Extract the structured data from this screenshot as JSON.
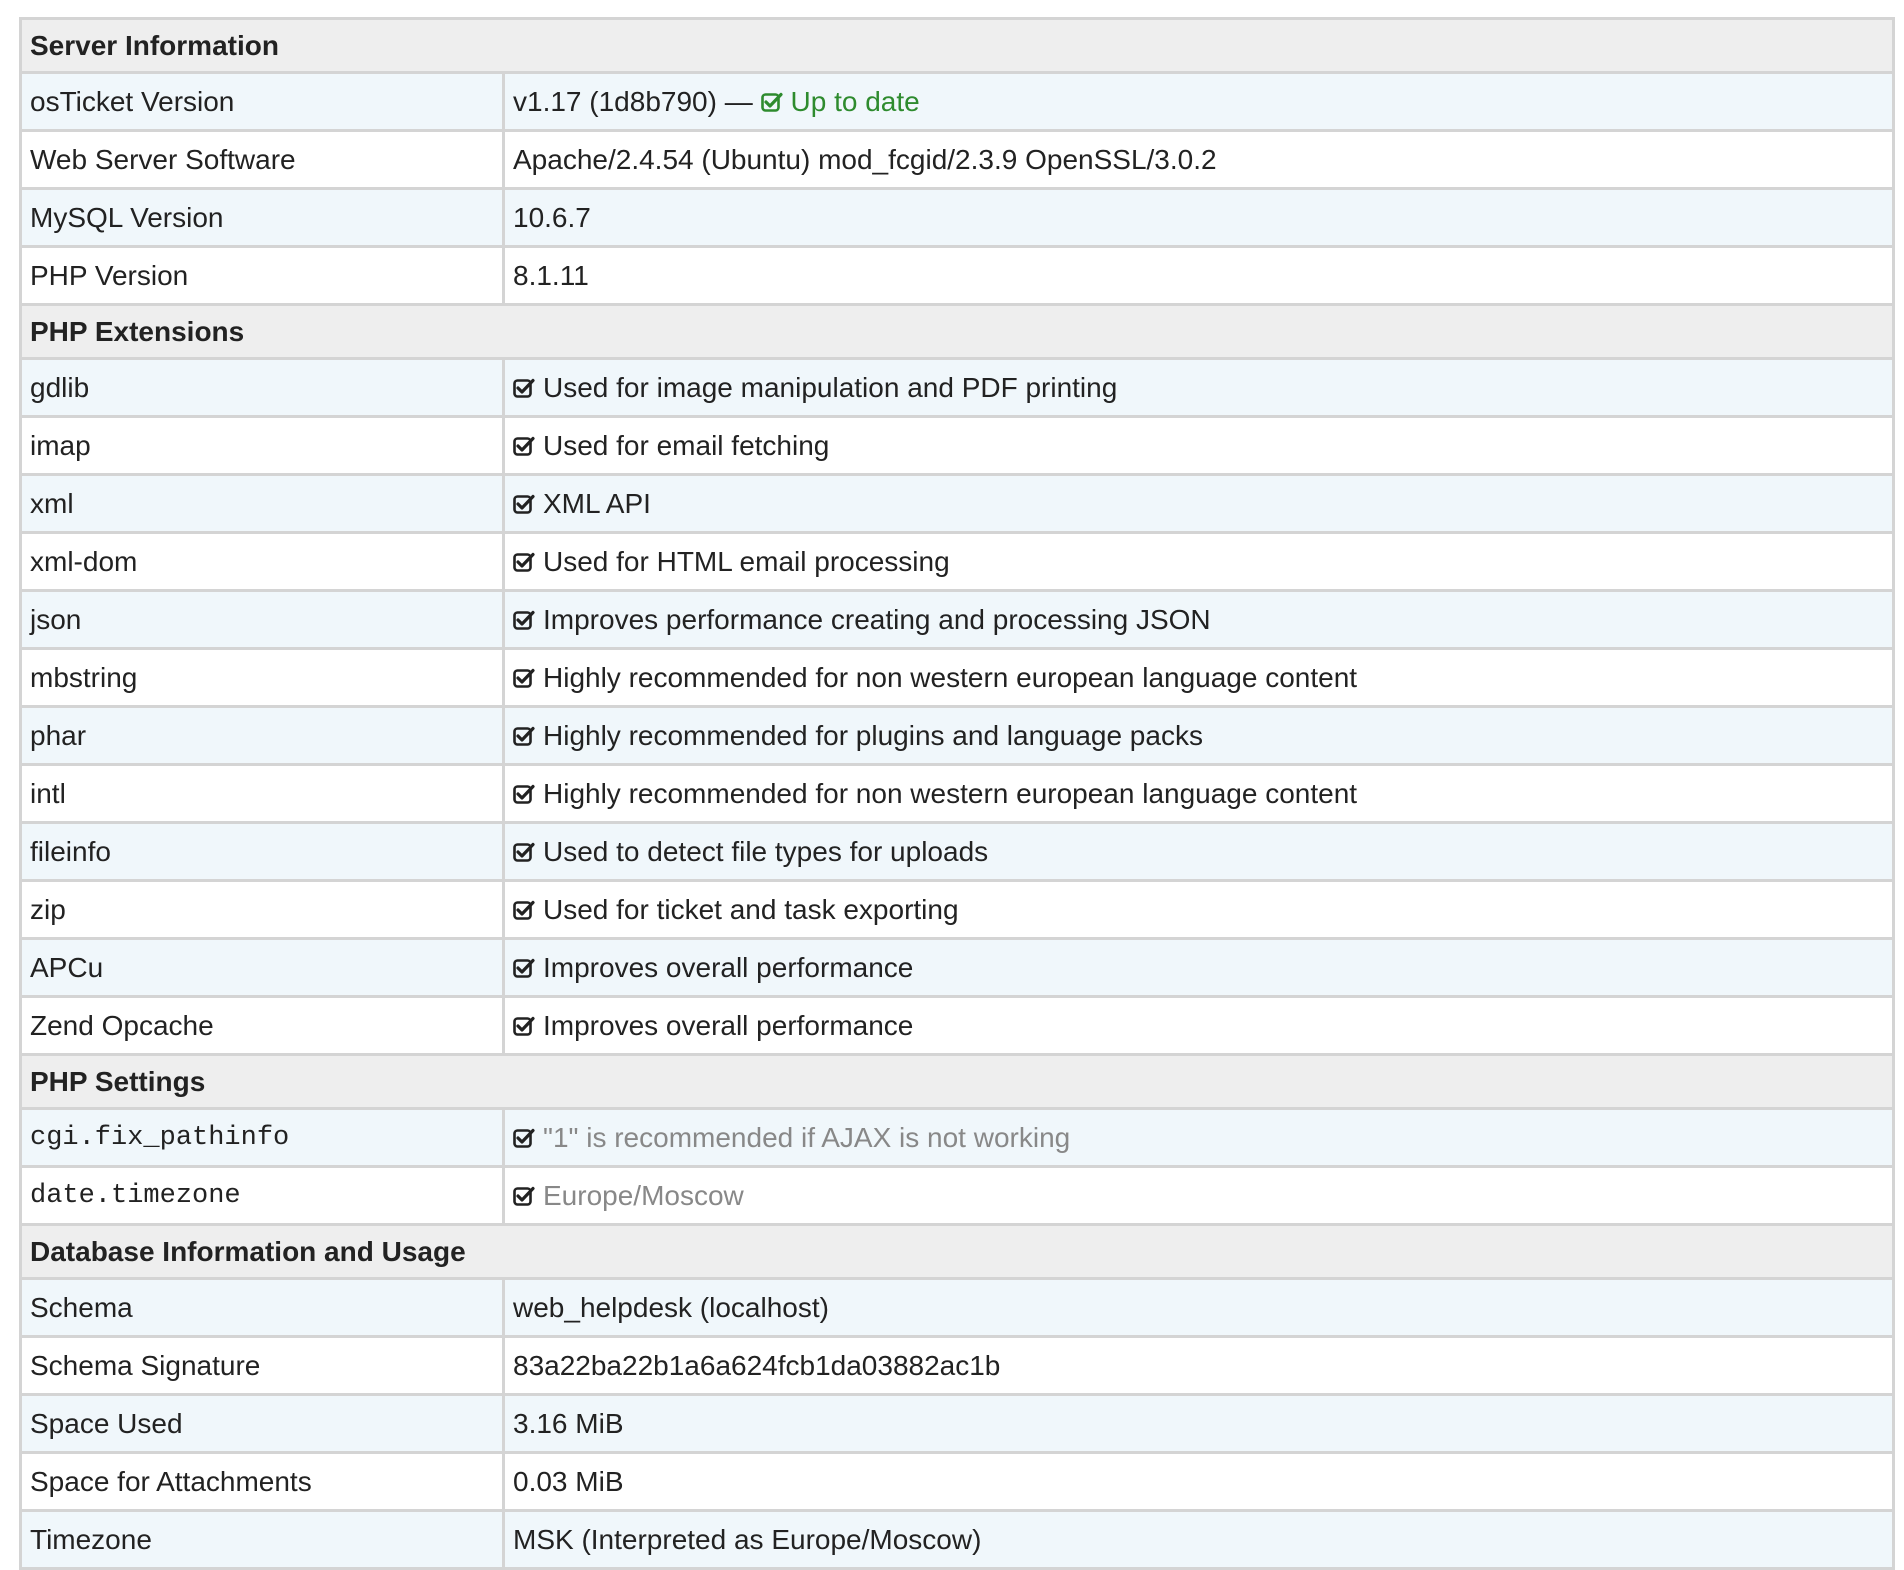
{
  "sections": {
    "server": {
      "title": "Server Information",
      "rows": [
        {
          "key": "osTicket Version",
          "value": "v1.17 (1d8b790) —",
          "status": "Up to date"
        },
        {
          "key": "Web Server Software",
          "value": "Apache/2.4.54 (Ubuntu) mod_fcgid/2.3.9 OpenSSL/3.0.2"
        },
        {
          "key": "MySQL Version",
          "value": "10.6.7"
        },
        {
          "key": "PHP Version",
          "value": "8.1.11"
        }
      ]
    },
    "extensions": {
      "title": "PHP Extensions",
      "rows": [
        {
          "key": "gdlib",
          "value": "Used for image manipulation and PDF printing"
        },
        {
          "key": "imap",
          "value": "Used for email fetching"
        },
        {
          "key": "xml",
          "value": "XML API"
        },
        {
          "key": "xml-dom",
          "value": "Used for HTML email processing"
        },
        {
          "key": "json",
          "value": "Improves performance creating and processing JSON"
        },
        {
          "key": "mbstring",
          "value": "Highly recommended for non western european language content"
        },
        {
          "key": "phar",
          "value": "Highly recommended for plugins and language packs"
        },
        {
          "key": "intl",
          "value": "Highly recommended for non western european language content"
        },
        {
          "key": "fileinfo",
          "value": "Used to detect file types for uploads"
        },
        {
          "key": "zip",
          "value": "Used for ticket and task exporting"
        },
        {
          "key": "APCu",
          "value": "Improves overall performance"
        },
        {
          "key": "Zend Opcache",
          "value": "Improves overall performance"
        }
      ]
    },
    "settings": {
      "title": "PHP Settings",
      "rows": [
        {
          "key": "cgi.fix_pathinfo",
          "value": "\"1\" is recommended if AJAX is not working"
        },
        {
          "key": "date.timezone",
          "value": "Europe/Moscow"
        }
      ]
    },
    "database": {
      "title": "Database Information and Usage",
      "rows": [
        {
          "key": "Schema",
          "value": "web_helpdesk (localhost)"
        },
        {
          "key": "Schema Signature",
          "value": "83a22ba22b1a6a624fcb1da03882ac1b"
        },
        {
          "key": "Space Used",
          "value": "3.16 MiB"
        },
        {
          "key": "Space for Attachments",
          "value": "0.03 MiB"
        },
        {
          "key": "Timezone",
          "value": "MSK (Interpreted as Europe/Moscow)"
        }
      ]
    }
  },
  "icons": {
    "check": "check-square-icon"
  },
  "colors": {
    "ok_green": "#2e8b2e",
    "muted_gray": "#888888",
    "section_bg": "#eeeeee",
    "row_alt_bg": "#f0f7fb",
    "border": "#d4d4d4"
  }
}
